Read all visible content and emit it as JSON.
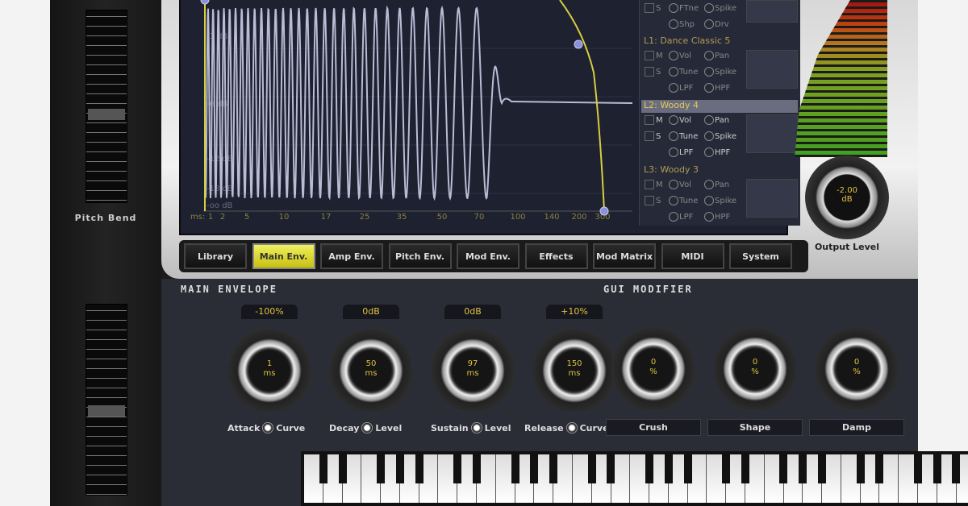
{
  "pitch_bend": {
    "label": "Pitch Bend"
  },
  "graph": {
    "y_labels": [
      "-3 dB",
      "-6 dB",
      "-12 dB",
      "-18 dB",
      "-oo dB"
    ],
    "x_unit": "ms:",
    "x_labels": [
      "1",
      "2",
      "5",
      "10",
      "17",
      "25",
      "35",
      "50",
      "70",
      "100",
      "140",
      "200",
      "300"
    ],
    "wave_color": "#b8bcd4",
    "envelope_color": "#d8cc40"
  },
  "layers": {
    "partial": {
      "row1": [
        "S",
        "FTne",
        "Spike"
      ],
      "row2": [
        "Shp",
        "Drv"
      ]
    },
    "items": [
      {
        "title": "L1: Dance Classic 5",
        "row1": [
          "M",
          "Vol",
          "Pan"
        ],
        "row2": [
          "S",
          "Tune",
          "Spike"
        ],
        "row3": [
          "LPF",
          "HPF"
        ]
      },
      {
        "title": "L2: Woody 4",
        "row1": [
          "M",
          "Vol",
          "Pan"
        ],
        "row2": [
          "S",
          "Tune",
          "Spike"
        ],
        "row3": [
          "LPF",
          "HPF"
        ],
        "selected": true
      },
      {
        "title": "L3: Woody 3",
        "row1": [
          "M",
          "Vol",
          "Pan"
        ],
        "row2": [
          "S",
          "Tune",
          "Spike"
        ],
        "row3": [
          "LPF",
          "HPF"
        ]
      }
    ]
  },
  "output": {
    "value": "-2.00",
    "unit": "dB",
    "label": "Output Level"
  },
  "tabs": [
    "Library",
    "Main Env.",
    "Amp Env.",
    "Pitch Env.",
    "Mod Env.",
    "Effects",
    "Mod Matrix",
    "MIDI",
    "System"
  ],
  "active_tab": "Main Env.",
  "main_envelope": {
    "title": "MAIN ENVELOPE",
    "knobs": [
      {
        "top": "-100%",
        "value": "1",
        "unit": "ms",
        "label": "Attack",
        "sub": "Curve"
      },
      {
        "top": "0dB",
        "value": "50",
        "unit": "ms",
        "label": "Decay",
        "sub": "Level"
      },
      {
        "top": "0dB",
        "value": "97",
        "unit": "ms",
        "label": "Sustain",
        "sub": "Level"
      },
      {
        "top": "+10%",
        "value": "150",
        "unit": "ms",
        "label": "Release",
        "sub": "Curve"
      }
    ]
  },
  "gui_modifier": {
    "title": "GUI MODIFIER",
    "knobs": [
      {
        "value": "0",
        "unit": "%",
        "label": "Crush"
      },
      {
        "value": "0",
        "unit": "%",
        "label": "Shape"
      },
      {
        "value": "0",
        "unit": "%",
        "label": "Damp"
      }
    ]
  }
}
